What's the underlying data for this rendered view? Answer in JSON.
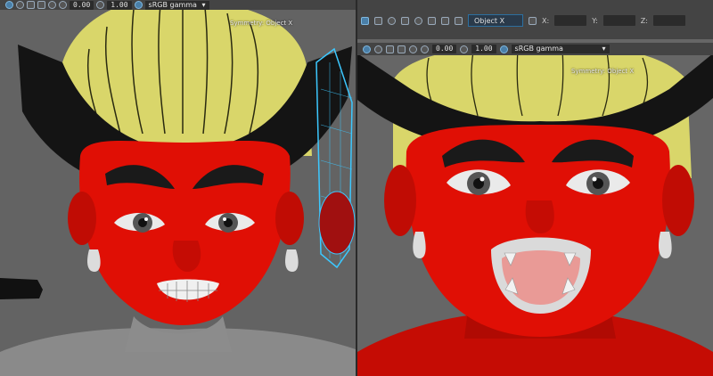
{
  "left_viewport": {
    "toolbar": {
      "value_a": "0.00",
      "value_b": "1.00",
      "color_space": "sRGB gamma"
    },
    "symmetry_label": "Symmetry: Object X"
  },
  "right_viewport": {
    "top_toolbar": {
      "symmetry_select": "Object X",
      "x_label": "X:",
      "y_label": "Y:",
      "z_label": "Z:"
    },
    "toolbar": {
      "value_a": "0.00",
      "value_b": "1.00",
      "color_space": "sRGB gamma"
    },
    "symmetry_label": "Symmetry: Object X"
  },
  "colors": {
    "skin": "#e00f05",
    "hair": "#e6e67a",
    "horn": "#141414",
    "mesh_wire": "#3cc8ff"
  }
}
